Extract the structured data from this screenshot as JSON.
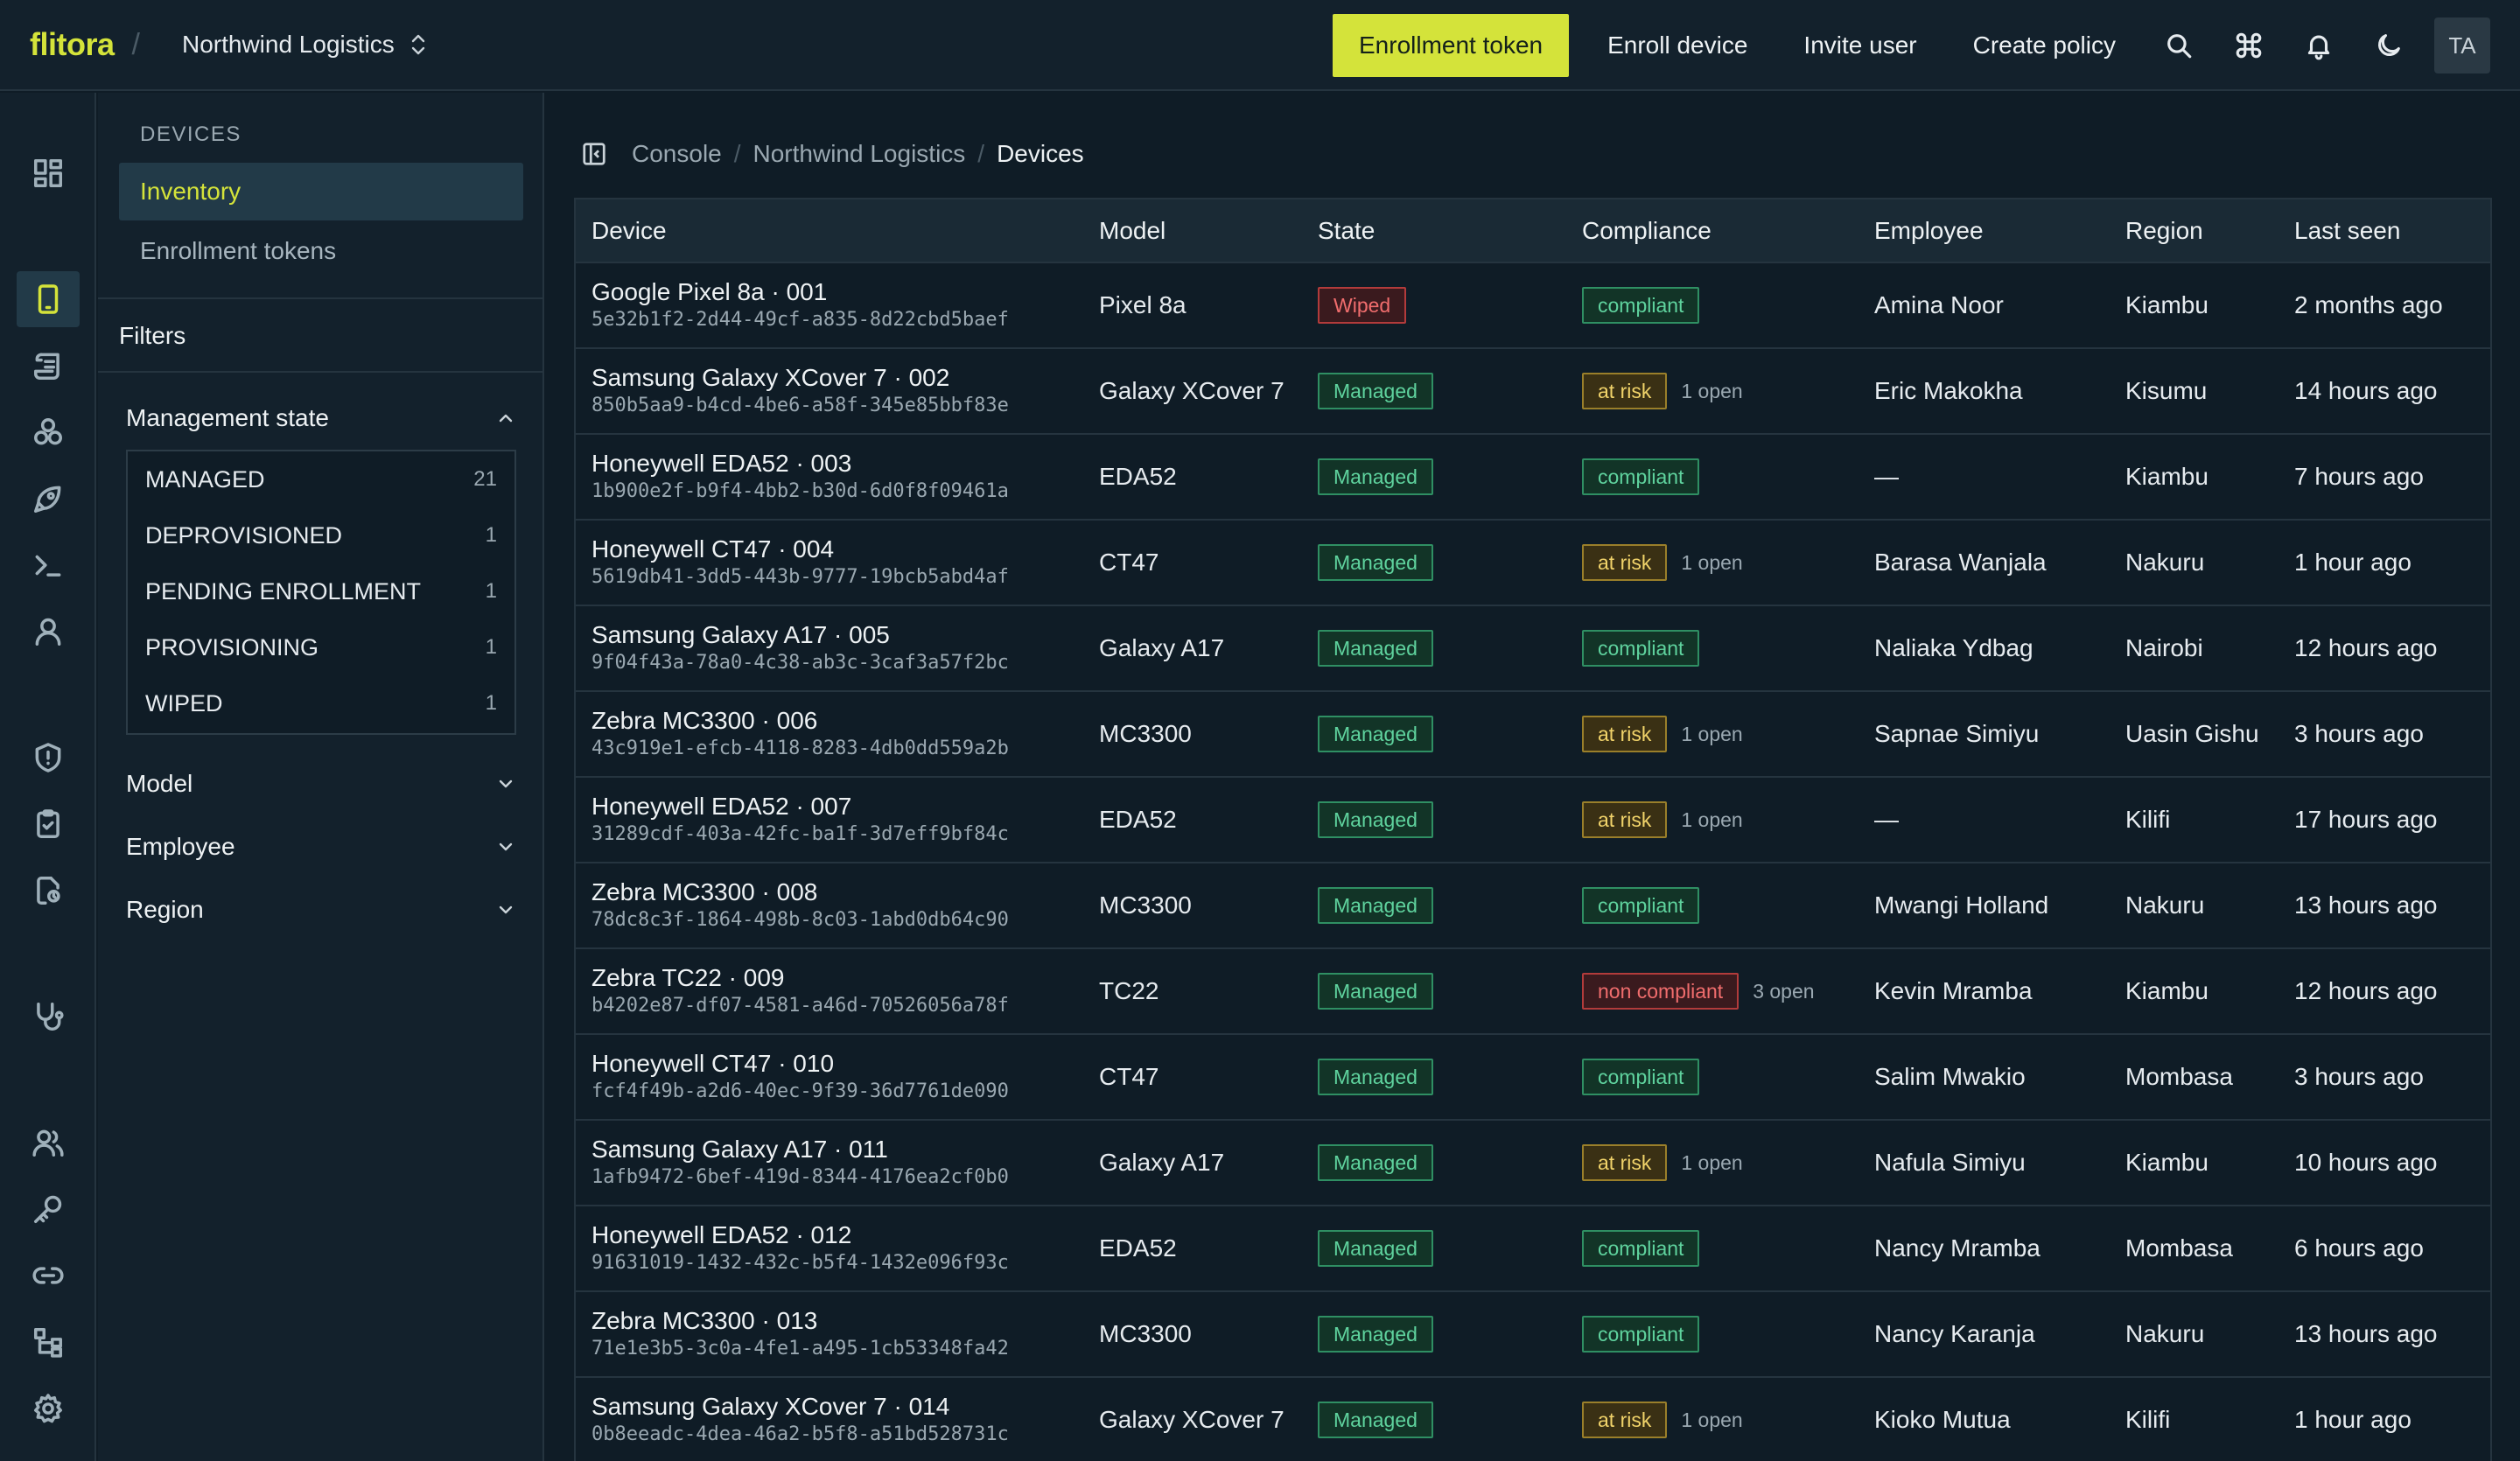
{
  "header": {
    "logo": "flitora",
    "separator": "/",
    "org_name": "Northwind Logistics",
    "actions": {
      "enrollment_token": "Enrollment token",
      "enroll_device": "Enroll device",
      "invite_user": "Invite user",
      "create_policy": "Create policy"
    },
    "avatar_initials": "TA",
    "accent_color": "#d4e33a"
  },
  "rail": {
    "icons": [
      "dashboard-icon",
      "device-icon",
      "policy-list-icon",
      "apps-icon",
      "rocket-icon",
      "terminal-icon",
      "user-icon",
      "shield-alert-icon",
      "clipboard-check-icon",
      "file-audit-icon",
      "stethoscope-icon",
      "users-icon",
      "key-icon",
      "link-icon",
      "hierarchy-icon",
      "gear-icon"
    ],
    "active": "device-icon"
  },
  "sidebar": {
    "section_label": "DEVICES",
    "items": [
      {
        "label": "Inventory",
        "active": true
      },
      {
        "label": "Enrollment tokens",
        "active": false
      }
    ],
    "filters_title": "Filters",
    "facets": {
      "management_state": {
        "label": "Management state",
        "options": [
          {
            "label": "MANAGED",
            "count": "21"
          },
          {
            "label": "DEPROVISIONED",
            "count": "1"
          },
          {
            "label": "PENDING ENROLLMENT",
            "count": "1"
          },
          {
            "label": "PROVISIONING",
            "count": "1"
          },
          {
            "label": "WIPED",
            "count": "1"
          }
        ]
      },
      "model": {
        "label": "Model"
      },
      "employee": {
        "label": "Employee"
      },
      "region": {
        "label": "Region"
      }
    }
  },
  "breadcrumb": {
    "items": [
      "Console",
      "Northwind Logistics",
      "Devices"
    ],
    "separator": "/"
  },
  "table": {
    "columns": [
      "Device",
      "Model",
      "State",
      "Compliance",
      "Employee",
      "Region",
      "Last seen"
    ],
    "rows": [
      {
        "name": "Google Pixel 8a · 001",
        "id": "5e32b1f2-2d44-49cf-a835-8d22cbd5baef",
        "model": "Pixel 8a",
        "state": "Wiped",
        "compliance": "compliant",
        "open": "",
        "employee": "Amina Noor",
        "region": "Kiambu",
        "last_seen": "2 months ago"
      },
      {
        "name": "Samsung Galaxy XCover 7 · 002",
        "id": "850b5aa9-b4cd-4be6-a58f-345e85bbf83e",
        "model": "Galaxy XCover 7",
        "state": "Managed",
        "compliance": "at risk",
        "open": "1 open",
        "employee": "Eric Makokha",
        "region": "Kisumu",
        "last_seen": "14 hours ago"
      },
      {
        "name": "Honeywell EDA52 · 003",
        "id": "1b900e2f-b9f4-4bb2-b30d-6d0f8f09461a",
        "model": "EDA52",
        "state": "Managed",
        "compliance": "compliant",
        "open": "",
        "employee": "—",
        "region": "Kiambu",
        "last_seen": "7 hours ago"
      },
      {
        "name": "Honeywell CT47 · 004",
        "id": "5619db41-3dd5-443b-9777-19bcb5abd4af",
        "model": "CT47",
        "state": "Managed",
        "compliance": "at risk",
        "open": "1 open",
        "employee": "Barasa Wanjala",
        "region": "Nakuru",
        "last_seen": "1 hour ago"
      },
      {
        "name": "Samsung Galaxy A17 · 005",
        "id": "9f04f43a-78a0-4c38-ab3c-3caf3a57f2bc",
        "model": "Galaxy A17",
        "state": "Managed",
        "compliance": "compliant",
        "open": "",
        "employee": "Naliaka Ydbag",
        "region": "Nairobi",
        "last_seen": "12 hours ago"
      },
      {
        "name": "Zebra MC3300 · 006",
        "id": "43c919e1-efcb-4118-8283-4db0dd559a2b",
        "model": "MC3300",
        "state": "Managed",
        "compliance": "at risk",
        "open": "1 open",
        "employee": "Sapnae Simiyu",
        "region": "Uasin Gishu",
        "last_seen": "3 hours ago"
      },
      {
        "name": "Honeywell EDA52 · 007",
        "id": "31289cdf-403a-42fc-ba1f-3d7eff9bf84c",
        "model": "EDA52",
        "state": "Managed",
        "compliance": "at risk",
        "open": "1 open",
        "employee": "—",
        "region": "Kilifi",
        "last_seen": "17 hours ago"
      },
      {
        "name": "Zebra MC3300 · 008",
        "id": "78dc8c3f-1864-498b-8c03-1abd0db64c90",
        "model": "MC3300",
        "state": "Managed",
        "compliance": "compliant",
        "open": "",
        "employee": "Mwangi Holland",
        "region": "Nakuru",
        "last_seen": "13 hours ago"
      },
      {
        "name": "Zebra TC22 · 009",
        "id": "b4202e87-df07-4581-a46d-70526056a78f",
        "model": "TC22",
        "state": "Managed",
        "compliance": "non compliant",
        "open": "3 open",
        "employee": "Kevin Mramba",
        "region": "Kiambu",
        "last_seen": "12 hours ago"
      },
      {
        "name": "Honeywell CT47 · 010",
        "id": "fcf4f49b-a2d6-40ec-9f39-36d7761de090",
        "model": "CT47",
        "state": "Managed",
        "compliance": "compliant",
        "open": "",
        "employee": "Salim Mwakio",
        "region": "Mombasa",
        "last_seen": "3 hours ago"
      },
      {
        "name": "Samsung Galaxy A17 · 011",
        "id": "1afb9472-6bef-419d-8344-4176ea2cf0b0",
        "model": "Galaxy A17",
        "state": "Managed",
        "compliance": "at risk",
        "open": "1 open",
        "employee": "Nafula Simiyu",
        "region": "Kiambu",
        "last_seen": "10 hours ago"
      },
      {
        "name": "Honeywell EDA52 · 012",
        "id": "91631019-1432-432c-b5f4-1432e096f93c",
        "model": "EDA52",
        "state": "Managed",
        "compliance": "compliant",
        "open": "",
        "employee": "Nancy Mramba",
        "region": "Mombasa",
        "last_seen": "6 hours ago"
      },
      {
        "name": "Zebra MC3300 · 013",
        "id": "71e1e3b5-3c0a-4fe1-a495-1cb53348fa42",
        "model": "MC3300",
        "state": "Managed",
        "compliance": "compliant",
        "open": "",
        "employee": "Nancy Karanja",
        "region": "Nakuru",
        "last_seen": "13 hours ago"
      },
      {
        "name": "Samsung Galaxy XCover 7 · 014",
        "id": "0b8eeadc-4dea-46a2-b5f8-a51bd528731c",
        "model": "Galaxy XCover 7",
        "state": "Managed",
        "compliance": "at risk",
        "open": "1 open",
        "employee": "Kioko Mutua",
        "region": "Kilifi",
        "last_seen": "1 hour ago"
      }
    ]
  }
}
